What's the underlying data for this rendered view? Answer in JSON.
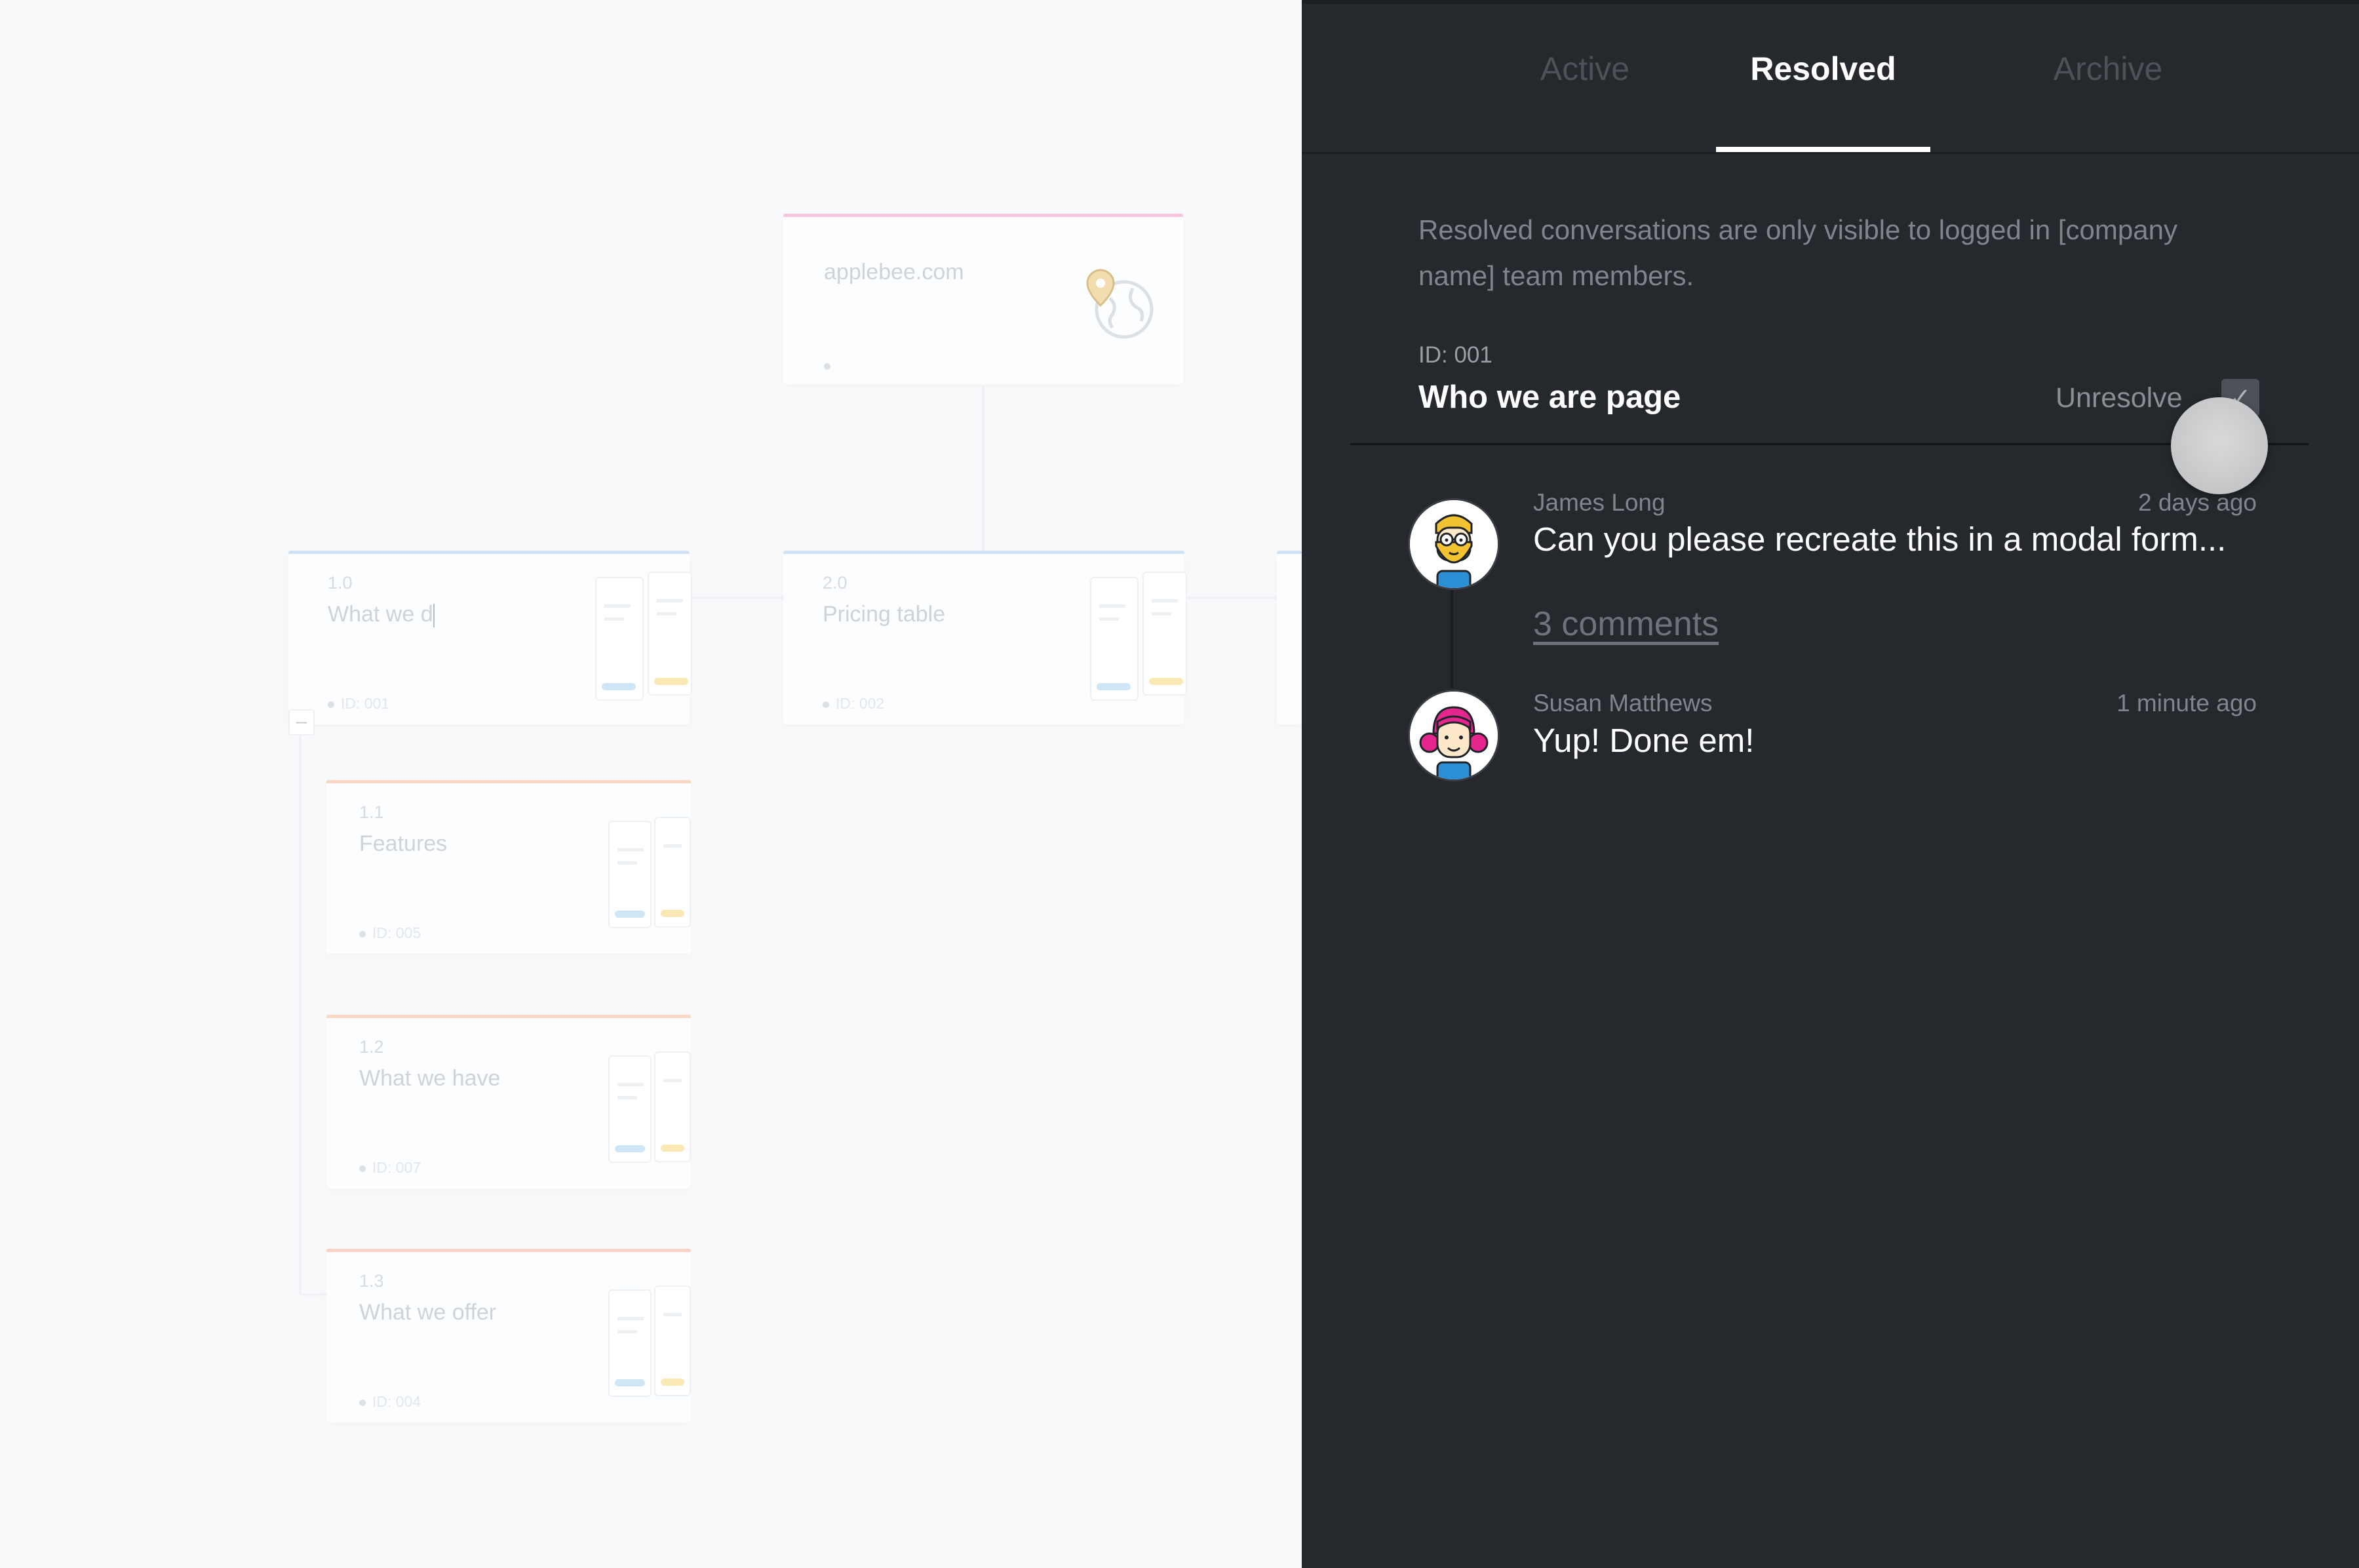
{
  "canvas": {
    "root_card": {
      "title": "applebee.com"
    },
    "cards": [
      {
        "number": "1.0",
        "title": "What we d",
        "id_label": "ID: 001"
      },
      {
        "number": "2.0",
        "title": "Pricing table",
        "id_label": "ID: 002"
      },
      {
        "number": "1.1",
        "title": "Features",
        "id_label": "ID: 005"
      },
      {
        "number": "1.2",
        "title": "What we have",
        "id_label": "ID: 007"
      },
      {
        "number": "1.3",
        "title": "What we offer",
        "id_label": "ID: 004"
      }
    ],
    "collapse_symbol": "–"
  },
  "panel": {
    "tabs": [
      {
        "label": "Active"
      },
      {
        "label": "Resolved"
      },
      {
        "label": "Archive"
      }
    ],
    "active_tab": "Resolved",
    "notice": "Resolved conversations are only visible to logged in [company name] team members.",
    "thread": {
      "id_label": "ID: 001",
      "title": "Who we are page",
      "unresolve_label": "Unresolve",
      "checkbox_glyph": "✓",
      "comments": [
        {
          "author": "James Long",
          "time": "2 days ago",
          "message": "Can you please recreate this in a modal form..."
        },
        {
          "author": "Susan Matthews",
          "time": "1 minute ago",
          "message": "Yup! Done em!"
        }
      ],
      "comments_link": "3 comments"
    }
  },
  "colors": {
    "panel_bg": "#25282c",
    "canvas_bg": "#f8f9fb",
    "accent_pink": "#ec4fa8",
    "accent_blue": "#9cc7ea",
    "accent_orange": "#f4a37a"
  }
}
